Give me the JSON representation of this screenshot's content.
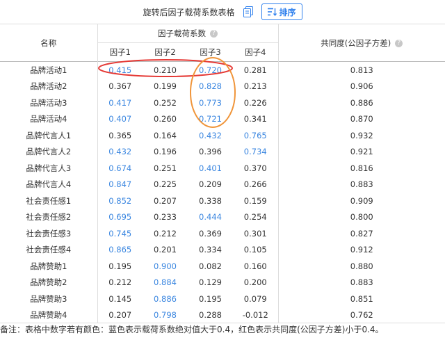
{
  "toolbar": {
    "title": "旋转后因子载荷系数表格",
    "sort_label": "排序",
    "copy_icon": "copy-icon",
    "sort_icon": "sort-list-icon"
  },
  "table": {
    "name_header": "名称",
    "group_header": "因子载荷系数",
    "factor_headers": [
      "因子1",
      "因子2",
      "因子3",
      "因子4"
    ],
    "communality_header": "共同度(公因子方差)",
    "rows": [
      {
        "name": "品牌活动1",
        "f": [
          "0.415",
          "0.210",
          "0.720",
          "0.281"
        ],
        "c": "0.813",
        "blue": [
          true,
          false,
          true,
          false
        ]
      },
      {
        "name": "品牌活动2",
        "f": [
          "0.367",
          "0.199",
          "0.828",
          "0.213"
        ],
        "c": "0.906",
        "blue": [
          false,
          false,
          true,
          false
        ]
      },
      {
        "name": "品牌活动3",
        "f": [
          "0.417",
          "0.252",
          "0.773",
          "0.226"
        ],
        "c": "0.886",
        "blue": [
          true,
          false,
          true,
          false
        ]
      },
      {
        "name": "品牌活动4",
        "f": [
          "0.407",
          "0.260",
          "0.721",
          "0.341"
        ],
        "c": "0.870",
        "blue": [
          true,
          false,
          true,
          false
        ]
      },
      {
        "name": "品牌代言人1",
        "f": [
          "0.365",
          "0.164",
          "0.432",
          "0.765"
        ],
        "c": "0.932",
        "blue": [
          false,
          false,
          true,
          true
        ]
      },
      {
        "name": "品牌代言人2",
        "f": [
          "0.432",
          "0.196",
          "0.396",
          "0.734"
        ],
        "c": "0.921",
        "blue": [
          true,
          false,
          false,
          true
        ]
      },
      {
        "name": "品牌代言人3",
        "f": [
          "0.674",
          "0.251",
          "0.401",
          "0.370"
        ],
        "c": "0.816",
        "blue": [
          true,
          false,
          true,
          false
        ]
      },
      {
        "name": "品牌代言人4",
        "f": [
          "0.847",
          "0.225",
          "0.209",
          "0.266"
        ],
        "c": "0.883",
        "blue": [
          true,
          false,
          false,
          false
        ]
      },
      {
        "name": "社会责任感1",
        "f": [
          "0.852",
          "0.207",
          "0.338",
          "0.159"
        ],
        "c": "0.909",
        "blue": [
          true,
          false,
          false,
          false
        ]
      },
      {
        "name": "社会责任感2",
        "f": [
          "0.695",
          "0.233",
          "0.444",
          "0.254"
        ],
        "c": "0.800",
        "blue": [
          true,
          false,
          true,
          false
        ]
      },
      {
        "name": "社会责任感3",
        "f": [
          "0.745",
          "0.212",
          "0.369",
          "0.301"
        ],
        "c": "0.827",
        "blue": [
          true,
          false,
          false,
          false
        ]
      },
      {
        "name": "社会责任感4",
        "f": [
          "0.865",
          "0.201",
          "0.334",
          "0.105"
        ],
        "c": "0.912",
        "blue": [
          true,
          false,
          false,
          false
        ]
      },
      {
        "name": "品牌赞助1",
        "f": [
          "0.195",
          "0.900",
          "0.082",
          "0.160"
        ],
        "c": "0.880",
        "blue": [
          false,
          true,
          false,
          false
        ]
      },
      {
        "name": "品牌赞助2",
        "f": [
          "0.212",
          "0.884",
          "0.129",
          "0.200"
        ],
        "c": "0.883",
        "blue": [
          false,
          true,
          false,
          false
        ]
      },
      {
        "name": "品牌赞助3",
        "f": [
          "0.145",
          "0.886",
          "0.195",
          "0.079"
        ],
        "c": "0.851",
        "blue": [
          false,
          true,
          false,
          false
        ]
      },
      {
        "name": "品牌赞助4",
        "f": [
          "0.207",
          "0.798",
          "0.288",
          "-0.012"
        ],
        "c": "0.762",
        "blue": [
          false,
          true,
          false,
          false
        ]
      }
    ]
  },
  "note": "备注：表格中数字若有颜色：蓝色表示载荷系数绝对值大于0.4，红色表示共同度(公因子方差)小于0.4。",
  "colors": {
    "blue_value": "#3a86e0",
    "accent": "#2f80ed",
    "annotation_red": "#e53935",
    "annotation_orange": "#f0953a"
  }
}
